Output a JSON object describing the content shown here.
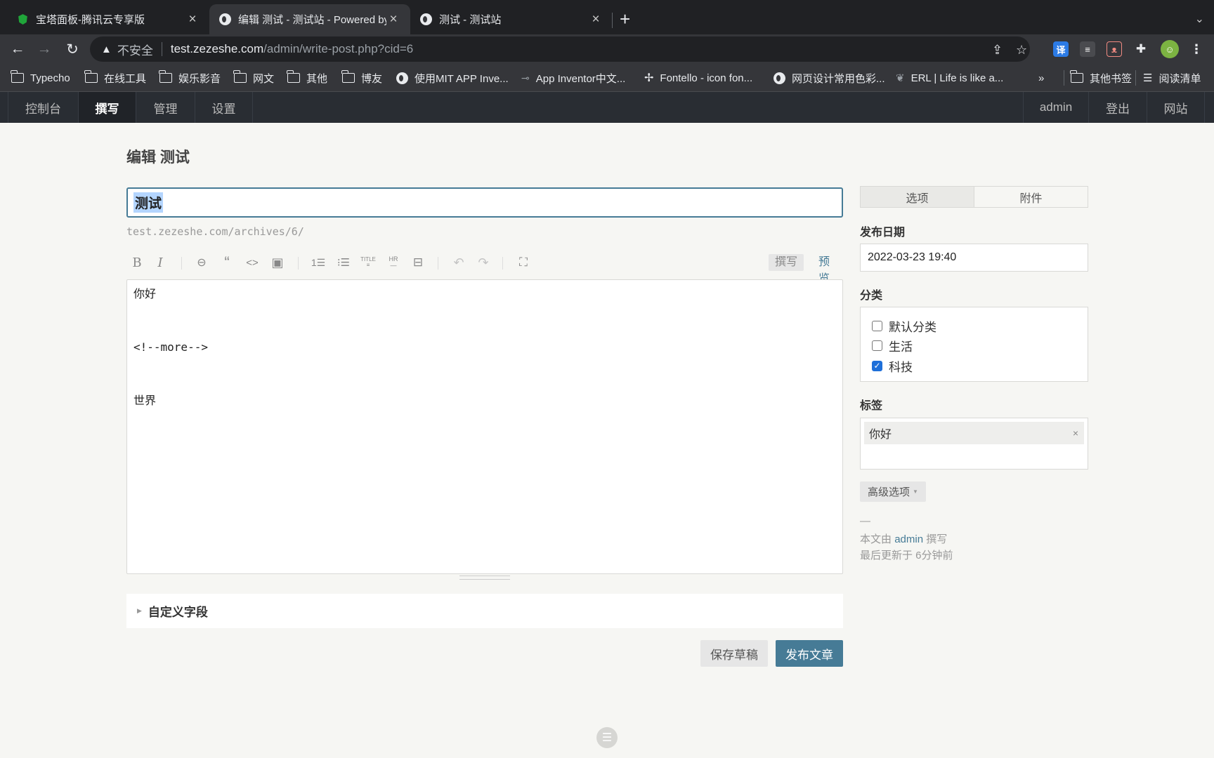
{
  "browser": {
    "tabs": [
      {
        "title": "宝塔面板-腾讯云专享版",
        "icon": "baota-icon"
      },
      {
        "title": "编辑 测试 - 测试站 - Powered by Typecho",
        "icon": "globe-icon"
      },
      {
        "title": "测试 - 测试站",
        "icon": "globe-icon"
      }
    ],
    "security_label": "不安全",
    "url_host": "test.zezeshe.com",
    "url_path": "/admin/write-post.php?cid=6",
    "bookmarks": [
      {
        "label": "Typecho",
        "icon": "folder-icon"
      },
      {
        "label": "在线工具",
        "icon": "folder-icon"
      },
      {
        "label": "娱乐影音",
        "icon": "folder-icon"
      },
      {
        "label": "网文",
        "icon": "folder-icon"
      },
      {
        "label": "其他",
        "icon": "folder-icon"
      },
      {
        "label": "博友",
        "icon": "folder-icon"
      },
      {
        "label": "使用MIT APP Inve...",
        "icon": "globe-icon"
      },
      {
        "label": "App Inventor中文...",
        "icon": "key-icon"
      },
      {
        "label": "Fontello - icon fon...",
        "icon": "fontello-icon"
      },
      {
        "label": "网页设计常用色彩...",
        "icon": "globe-icon"
      },
      {
        "label": "ERL | Life is like a...",
        "icon": "leaf-icon"
      }
    ],
    "bookmarks_overflow": "»",
    "other_bookmarks": "其他书签",
    "reading_list": "阅读清单"
  },
  "admin_menu": {
    "left": [
      "控制台",
      "撰写",
      "管理",
      "设置"
    ],
    "right": [
      "admin",
      "登出",
      "网站"
    ]
  },
  "page": {
    "title": "编辑 测试",
    "post_title": "测试",
    "permalink": "test.zezeshe.com/archives/6/",
    "mode_write": "撰写",
    "mode_preview": "预览",
    "content_lines": [
      "你好",
      "",
      "<!--more-->",
      "",
      "世界"
    ],
    "custom_fields": "自定义字段",
    "save_draft": "保存草稿",
    "publish": "发布文章"
  },
  "sidebar": {
    "tabs": [
      "选项",
      "附件"
    ],
    "date_label": "发布日期",
    "date_value": "2022-03-23 19:40",
    "category_label": "分类",
    "categories": [
      {
        "name": "默认分类",
        "checked": false
      },
      {
        "name": "生活",
        "checked": false
      },
      {
        "name": "科技",
        "checked": true
      }
    ],
    "tag_label": "标签",
    "tags": [
      "你好"
    ],
    "tag_remove": "×",
    "advanced": "高级选项",
    "meta_dash": "—",
    "meta_author_prefix": "本文由",
    "meta_author": "admin",
    "meta_author_suffix": "撰写",
    "meta_updated": "最后更新于 6分钟前"
  },
  "colors": {
    "accent": "#467b96",
    "admin_bar": "#292d33",
    "page_bg": "#f6f6f3",
    "chrome_dark": "#202124",
    "chrome_mid": "#35363a"
  }
}
